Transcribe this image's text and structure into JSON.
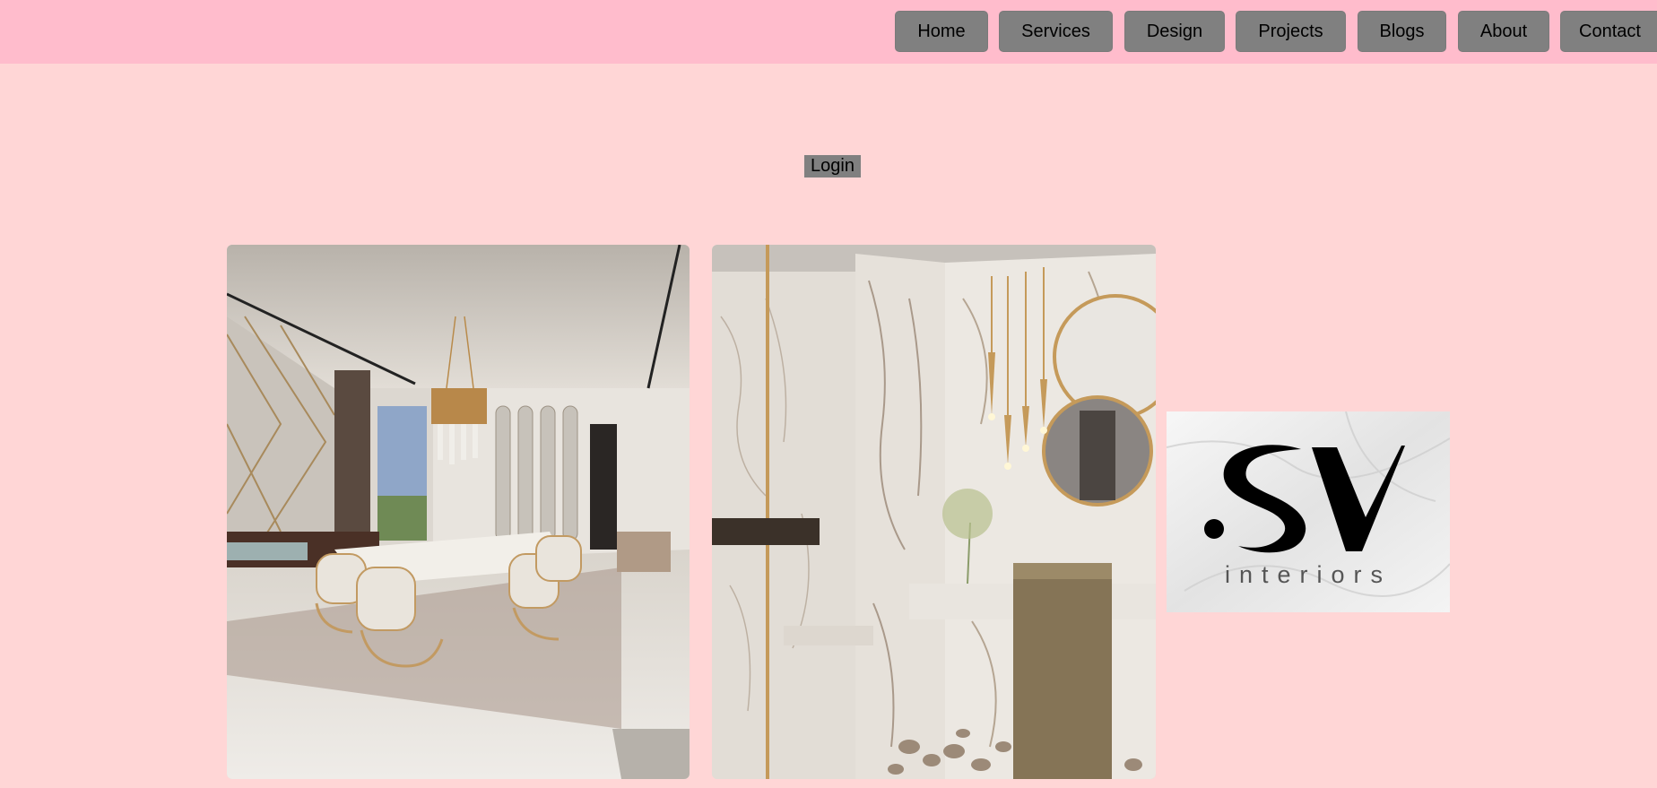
{
  "nav": {
    "items": [
      {
        "label": "Home"
      },
      {
        "label": "Services"
      },
      {
        "label": "Design"
      },
      {
        "label": "Projects"
      },
      {
        "label": "Blogs"
      },
      {
        "label": "About"
      },
      {
        "label": "Contact"
      }
    ]
  },
  "login": {
    "label": "Login"
  },
  "gallery": {
    "images": [
      {
        "name": "dining-room-photo"
      },
      {
        "name": "bathroom-photo"
      }
    ]
  },
  "logo": {
    "tagline": "interiors"
  },
  "colors": {
    "header_bg": "#ffbccc",
    "page_bg": "#ffd6d6",
    "button_bg": "#808080"
  }
}
